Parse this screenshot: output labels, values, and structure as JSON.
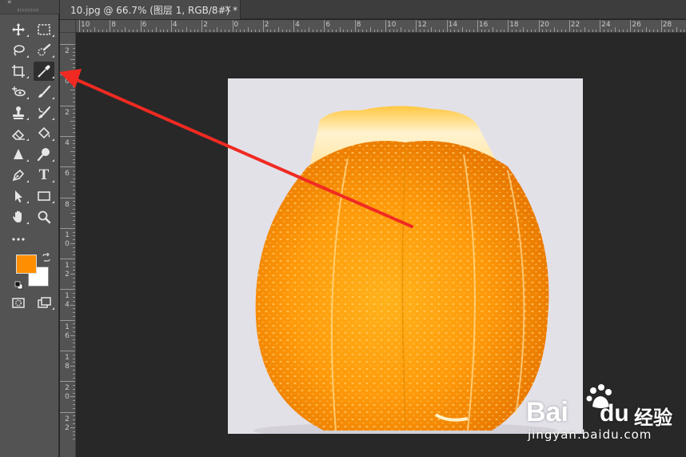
{
  "document_tab": {
    "title": "10.jpg @ 66.7% (图层 1, RGB/8#) *",
    "close_glyph": "×"
  },
  "toolbar": {
    "collapse_glyph": "«",
    "tools": [
      {
        "name": "move-tool",
        "icon": "move-icon"
      },
      {
        "name": "marquee-tool",
        "icon": "rect-marquee-icon"
      },
      {
        "name": "lasso-tool",
        "icon": "lasso-icon"
      },
      {
        "name": "quick-select-tool",
        "icon": "quick-selection-icon"
      },
      {
        "name": "crop-tool",
        "icon": "crop-icon"
      },
      {
        "name": "eyedropper-tool",
        "icon": "eyedropper-icon",
        "active": true
      },
      {
        "name": "spot-healing-tool",
        "icon": "spot-healing-icon"
      },
      {
        "name": "brush-tool",
        "icon": "brush-icon"
      },
      {
        "name": "clone-stamp-tool",
        "icon": "stamp-icon"
      },
      {
        "name": "history-brush-tool",
        "icon": "history-brush-icon"
      },
      {
        "name": "eraser-tool",
        "icon": "eraser-icon"
      },
      {
        "name": "paint-bucket-tool",
        "icon": "paint-bucket-icon"
      },
      {
        "name": "blur-tool",
        "icon": "blur-icon"
      },
      {
        "name": "dodge-tool",
        "icon": "dodge-icon"
      },
      {
        "name": "pen-tool",
        "icon": "pen-icon"
      },
      {
        "name": "type-tool",
        "icon": "type-icon",
        "glyph": "T"
      },
      {
        "name": "path-select-tool",
        "icon": "path-select-icon"
      },
      {
        "name": "rectangle-tool",
        "icon": "rectangle-icon"
      },
      {
        "name": "hand-tool",
        "icon": "hand-icon"
      },
      {
        "name": "zoom-tool",
        "icon": "zoom-icon"
      },
      {
        "name": "edit-toolbar",
        "icon": "more-icon"
      }
    ],
    "foreground_color": "#ff8f00",
    "background_color": "#ffffff"
  },
  "rulers": {
    "horizontal_labels": [
      "10",
      "8",
      "6",
      "4",
      "2",
      "0",
      "2",
      "4",
      "6",
      "8",
      "10",
      "12",
      "14",
      "16",
      "18",
      "20",
      "22",
      "24",
      "26",
      "28"
    ],
    "vertical_labels": [
      "2",
      "0",
      "2",
      "4",
      "6",
      "8",
      "10",
      "12",
      "14",
      "16",
      "18",
      "20",
      "22"
    ]
  },
  "canvas": {
    "background": "#282828",
    "image_subject": "peeled orange",
    "image_background": "#e3e1e8"
  },
  "annotation": {
    "arrow_color": "#f02a22"
  },
  "watermark": {
    "bai": "Bai",
    "du": "du",
    "jingyan": "经验",
    "url": "jingyan.baidu.com"
  }
}
